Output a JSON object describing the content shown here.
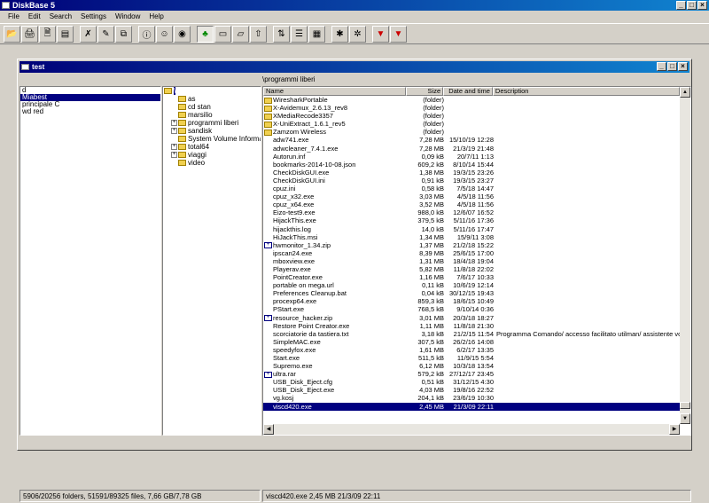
{
  "app": {
    "title": "DiskBase 5"
  },
  "menu": [
    "File",
    "Edit",
    "Search",
    "Settings",
    "Window",
    "Help"
  ],
  "toolbar_icons": [
    "open-folder-icon",
    "print-icon",
    "print-preview-icon",
    "scan-disk-icon",
    "delete-disk-icon",
    "rename-disk-icon",
    "copy-icon",
    "info-icon",
    "user-icon",
    "disk-icon",
    "tree-icon",
    "folder-icon",
    "folder-open-icon",
    "folder-up-icon",
    "sort-icon",
    "list-view-icon",
    "details-view-icon",
    "search-icon",
    "search-advanced-icon",
    "export-icon",
    "export-all-icon"
  ],
  "document": {
    "title": "test"
  },
  "drives": {
    "search_value": "d",
    "items": [
      "Miabest",
      "principale C",
      "wd red"
    ],
    "selected": 0
  },
  "tree": {
    "root": "\\",
    "items": [
      {
        "label": "as",
        "expandable": false
      },
      {
        "label": "cd stan",
        "expandable": false
      },
      {
        "label": "marsilio",
        "expandable": false
      },
      {
        "label": "programmi liberi",
        "expandable": true
      },
      {
        "label": "sandisk",
        "expandable": true
      },
      {
        "label": "System Volume Information",
        "expandable": false
      },
      {
        "label": "total64",
        "expandable": true
      },
      {
        "label": "viaggi",
        "expandable": true
      },
      {
        "label": "video",
        "expandable": false
      }
    ]
  },
  "files": {
    "path": "\\programmi liberi",
    "columns": {
      "name": "Name",
      "size": "Size",
      "date": "Date and time",
      "desc": "Description"
    },
    "rows": [
      {
        "name": "WiresharkPortable",
        "size": "(folder)",
        "date": "",
        "desc": "",
        "type": "folder"
      },
      {
        "name": "X-Avidemux_2.6.13_rev8",
        "size": "(folder)",
        "date": "",
        "desc": "",
        "type": "folder"
      },
      {
        "name": "XMediaRecode3357",
        "size": "(folder)",
        "date": "",
        "desc": "",
        "type": "folder"
      },
      {
        "name": "X-UniExtract_1.6.1_rev5",
        "size": "(folder)",
        "date": "",
        "desc": "",
        "type": "folder"
      },
      {
        "name": "Zamzom Wireless",
        "size": "(folder)",
        "date": "",
        "desc": "",
        "type": "folder"
      },
      {
        "name": "adw741.exe",
        "size": "7,28 MB",
        "date": "15/10/19 12:28",
        "desc": "",
        "type": "file"
      },
      {
        "name": "adwcleaner_7.4.1.exe",
        "size": "7,28 MB",
        "date": "21/3/19 21:48",
        "desc": "",
        "type": "file"
      },
      {
        "name": "Autorun.inf",
        "size": "0,09 kB",
        "date": "20/7/11  1:13",
        "desc": "",
        "type": "file"
      },
      {
        "name": "bookmarks-2014-10-08.json",
        "size": "609,2 kB",
        "date": "8/10/14 15:44",
        "desc": "",
        "type": "file"
      },
      {
        "name": "CheckDiskGUI.exe",
        "size": "1,38 MB",
        "date": "19/3/15 23:26",
        "desc": "",
        "type": "file"
      },
      {
        "name": "CheckDiskGUI.ini",
        "size": "0,91 kB",
        "date": "19/3/15 23:27",
        "desc": "",
        "type": "file"
      },
      {
        "name": "cpuz.ini",
        "size": "0,58 kB",
        "date": "7/5/18 14:47",
        "desc": "",
        "type": "file"
      },
      {
        "name": "cpuz_x32.exe",
        "size": "3,03 MB",
        "date": "4/5/18 11:56",
        "desc": "",
        "type": "file"
      },
      {
        "name": "cpuz_x64.exe",
        "size": "3,52 MB",
        "date": "4/5/18 11:56",
        "desc": "",
        "type": "file"
      },
      {
        "name": "Eizo-test9.exe",
        "size": "988,0 kB",
        "date": "12/6/07 16:52",
        "desc": "",
        "type": "file"
      },
      {
        "name": "HijackThis.exe",
        "size": "379,5 kB",
        "date": "5/11/16 17:36",
        "desc": "",
        "type": "file"
      },
      {
        "name": "hijackthis.log",
        "size": "14,0 kB",
        "date": "5/11/16 17:47",
        "desc": "",
        "type": "file"
      },
      {
        "name": "HiJackThis.msi",
        "size": "1,34 MB",
        "date": "15/9/11  3:08",
        "desc": "",
        "type": "file"
      },
      {
        "name": "hwmonitor_1.34.zip",
        "size": "1,37 MB",
        "date": "21/2/18 15:22",
        "desc": "",
        "type": "zip"
      },
      {
        "name": "ipscan24.exe",
        "size": "8,39 MB",
        "date": "25/6/15 17:00",
        "desc": "",
        "type": "file"
      },
      {
        "name": "mboxview.exe",
        "size": "1,31 MB",
        "date": "18/4/18 19:04",
        "desc": "",
        "type": "file"
      },
      {
        "name": "Playerav.exe",
        "size": "5,82 MB",
        "date": "11/8/18 22:02",
        "desc": "",
        "type": "file"
      },
      {
        "name": "PointCreator.exe",
        "size": "1,16 MB",
        "date": "7/6/17 10:33",
        "desc": "",
        "type": "file"
      },
      {
        "name": "portable on mega.url",
        "size": "0,11 kB",
        "date": "10/6/19 12:14",
        "desc": "",
        "type": "file"
      },
      {
        "name": "Preferences Cleanup.bat",
        "size": "0,04 kB",
        "date": "30/12/15 19:43",
        "desc": "",
        "type": "file"
      },
      {
        "name": "procexp64.exe",
        "size": "859,3 kB",
        "date": "18/6/15 10:49",
        "desc": "",
        "type": "file"
      },
      {
        "name": "PStart.exe",
        "size": "768,5 kB",
        "date": "9/10/14  0:36",
        "desc": "",
        "type": "file"
      },
      {
        "name": "resource_hacker.zip",
        "size": "3,01 MB",
        "date": "20/3/18 18:27",
        "desc": "",
        "type": "zip"
      },
      {
        "name": "Restore Point Creator.exe",
        "size": "1,11 MB",
        "date": "11/8/18 21:30",
        "desc": "",
        "type": "file"
      },
      {
        "name": "scorciatorie da tastiera.txt",
        "size": "3,18 kB",
        "date": "21/2/15 11:54",
        "desc": "Programma Comando/ accesso facilitato utilman/ assistente vocal",
        "type": "file"
      },
      {
        "name": "SimpleMAC.exe",
        "size": "307,5 kB",
        "date": "26/2/16 14:08",
        "desc": "",
        "type": "file"
      },
      {
        "name": "speedyfox.exe",
        "size": "1,61 MB",
        "date": "6/2/17 13:35",
        "desc": "",
        "type": "file"
      },
      {
        "name": "Start.exe",
        "size": "511,5 kB",
        "date": "11/9/15  5:54",
        "desc": "",
        "type": "file"
      },
      {
        "name": "Supremo.exe",
        "size": "6,12 MB",
        "date": "10/3/18 13:54",
        "desc": "",
        "type": "file"
      },
      {
        "name": "ultra.rar",
        "size": "579,2 kB",
        "date": "27/12/17 23:45",
        "desc": "",
        "type": "zip"
      },
      {
        "name": "USB_Disk_Eject.cfg",
        "size": "0,51 kB",
        "date": "31/12/15  4:30",
        "desc": "",
        "type": "file"
      },
      {
        "name": "USB_Disk_Eject.exe",
        "size": "4,03 MB",
        "date": "19/8/16 22:52",
        "desc": "",
        "type": "file"
      },
      {
        "name": "vg.kosj",
        "size": "204,1 kB",
        "date": "23/6/19 10:30",
        "desc": "",
        "type": "file"
      },
      {
        "name": "viscd420.exe",
        "size": "2,45 MB",
        "date": "21/3/09 22:11",
        "desc": "",
        "type": "file"
      }
    ],
    "selected": 38
  },
  "status": {
    "left": "5906/20256 folders, 51591/89325 files, 7,66 GB/7,78 GB",
    "right": "viscd420.exe   2,45 MB   21/3/09 22:11"
  }
}
